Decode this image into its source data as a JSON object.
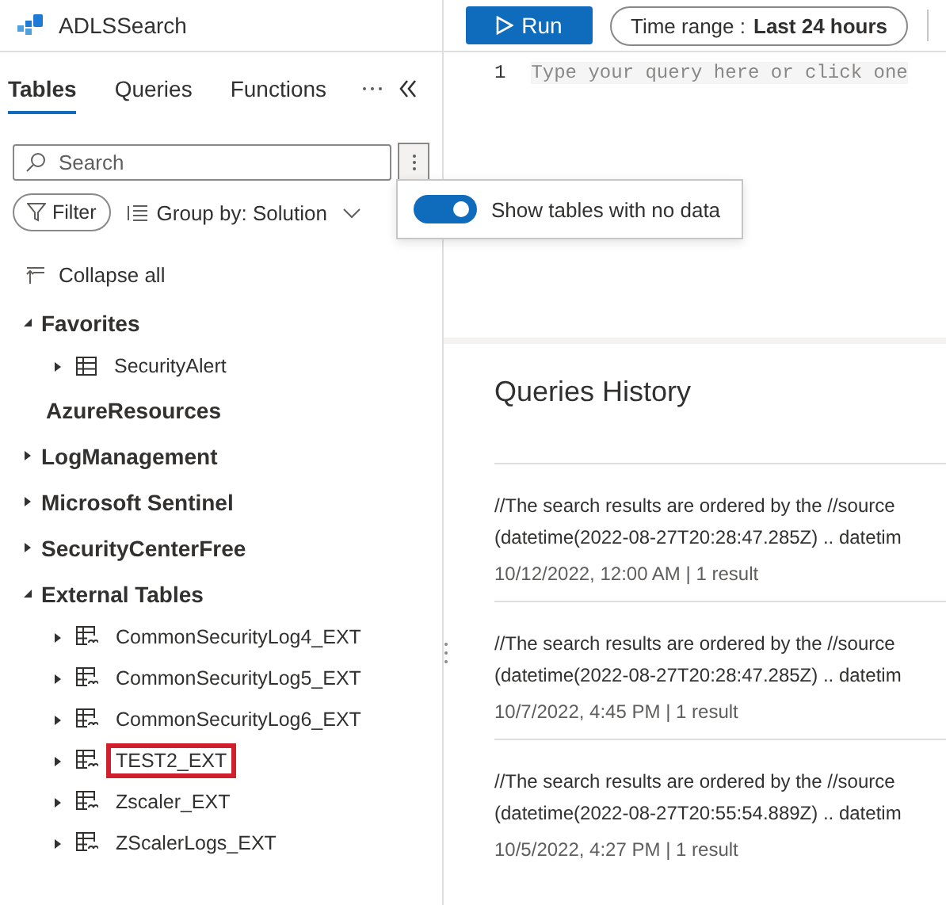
{
  "app": {
    "title": "ADLSSearch"
  },
  "toolbar": {
    "run_label": "Run",
    "time_range_label": "Time range :",
    "time_range_value": "Last 24 hours"
  },
  "tabs": [
    {
      "label": "Tables",
      "selected": true
    },
    {
      "label": "Queries",
      "selected": false
    },
    {
      "label": "Functions",
      "selected": false
    }
  ],
  "search": {
    "placeholder": "Search"
  },
  "filter_label": "Filter",
  "group_by": "Group by: Solution",
  "options_popup": {
    "label": "Show tables with no data",
    "on": true
  },
  "collapse_all": "Collapse all",
  "tree": [
    {
      "label": "Favorites",
      "expanded": true,
      "children": [
        {
          "label": "SecurityAlert",
          "kind": "table",
          "highlighted": false
        }
      ]
    },
    {
      "label": "AzureResources"
    },
    {
      "label": "LogManagement",
      "expanded": false
    },
    {
      "label": "Microsoft Sentinel",
      "expanded": false
    },
    {
      "label": "SecurityCenterFree",
      "expanded": false
    },
    {
      "label": "External Tables",
      "expanded": true,
      "children": [
        {
          "label": "CommonSecurityLog4_EXT",
          "kind": "external",
          "highlighted": false
        },
        {
          "label": "CommonSecurityLog5_EXT",
          "kind": "external",
          "highlighted": false
        },
        {
          "label": "CommonSecurityLog6_EXT",
          "kind": "external",
          "highlighted": false
        },
        {
          "label": "TEST2_EXT",
          "kind": "external",
          "highlighted": true
        },
        {
          "label": "Zscaler_EXT",
          "kind": "external",
          "highlighted": false
        },
        {
          "label": "ZScalerLogs_EXT",
          "kind": "external",
          "highlighted": false
        }
      ]
    }
  ],
  "editor": {
    "line_number": "1",
    "placeholder": "Type your query here or click one"
  },
  "history": {
    "title": "Queries History",
    "entries": [
      {
        "line_1": "//The search results are ordered by the //source",
        "line_2": "(datetime(2022-08-27T20:28:47.285Z) .. datetim",
        "meta": "10/12/2022, 12:00 AM | 1 result"
      },
      {
        "line_1": "//The search results are ordered by the //source",
        "line_2": "(datetime(2022-08-27T20:28:47.285Z) .. datetim",
        "meta": "10/7/2022, 4:45 PM | 1 result"
      },
      {
        "line_1": "//The search results are ordered by the //source",
        "line_2": "(datetime(2022-08-27T20:55:54.889Z) .. datetim",
        "meta": "10/5/2022, 4:27 PM | 1 result"
      }
    ]
  }
}
